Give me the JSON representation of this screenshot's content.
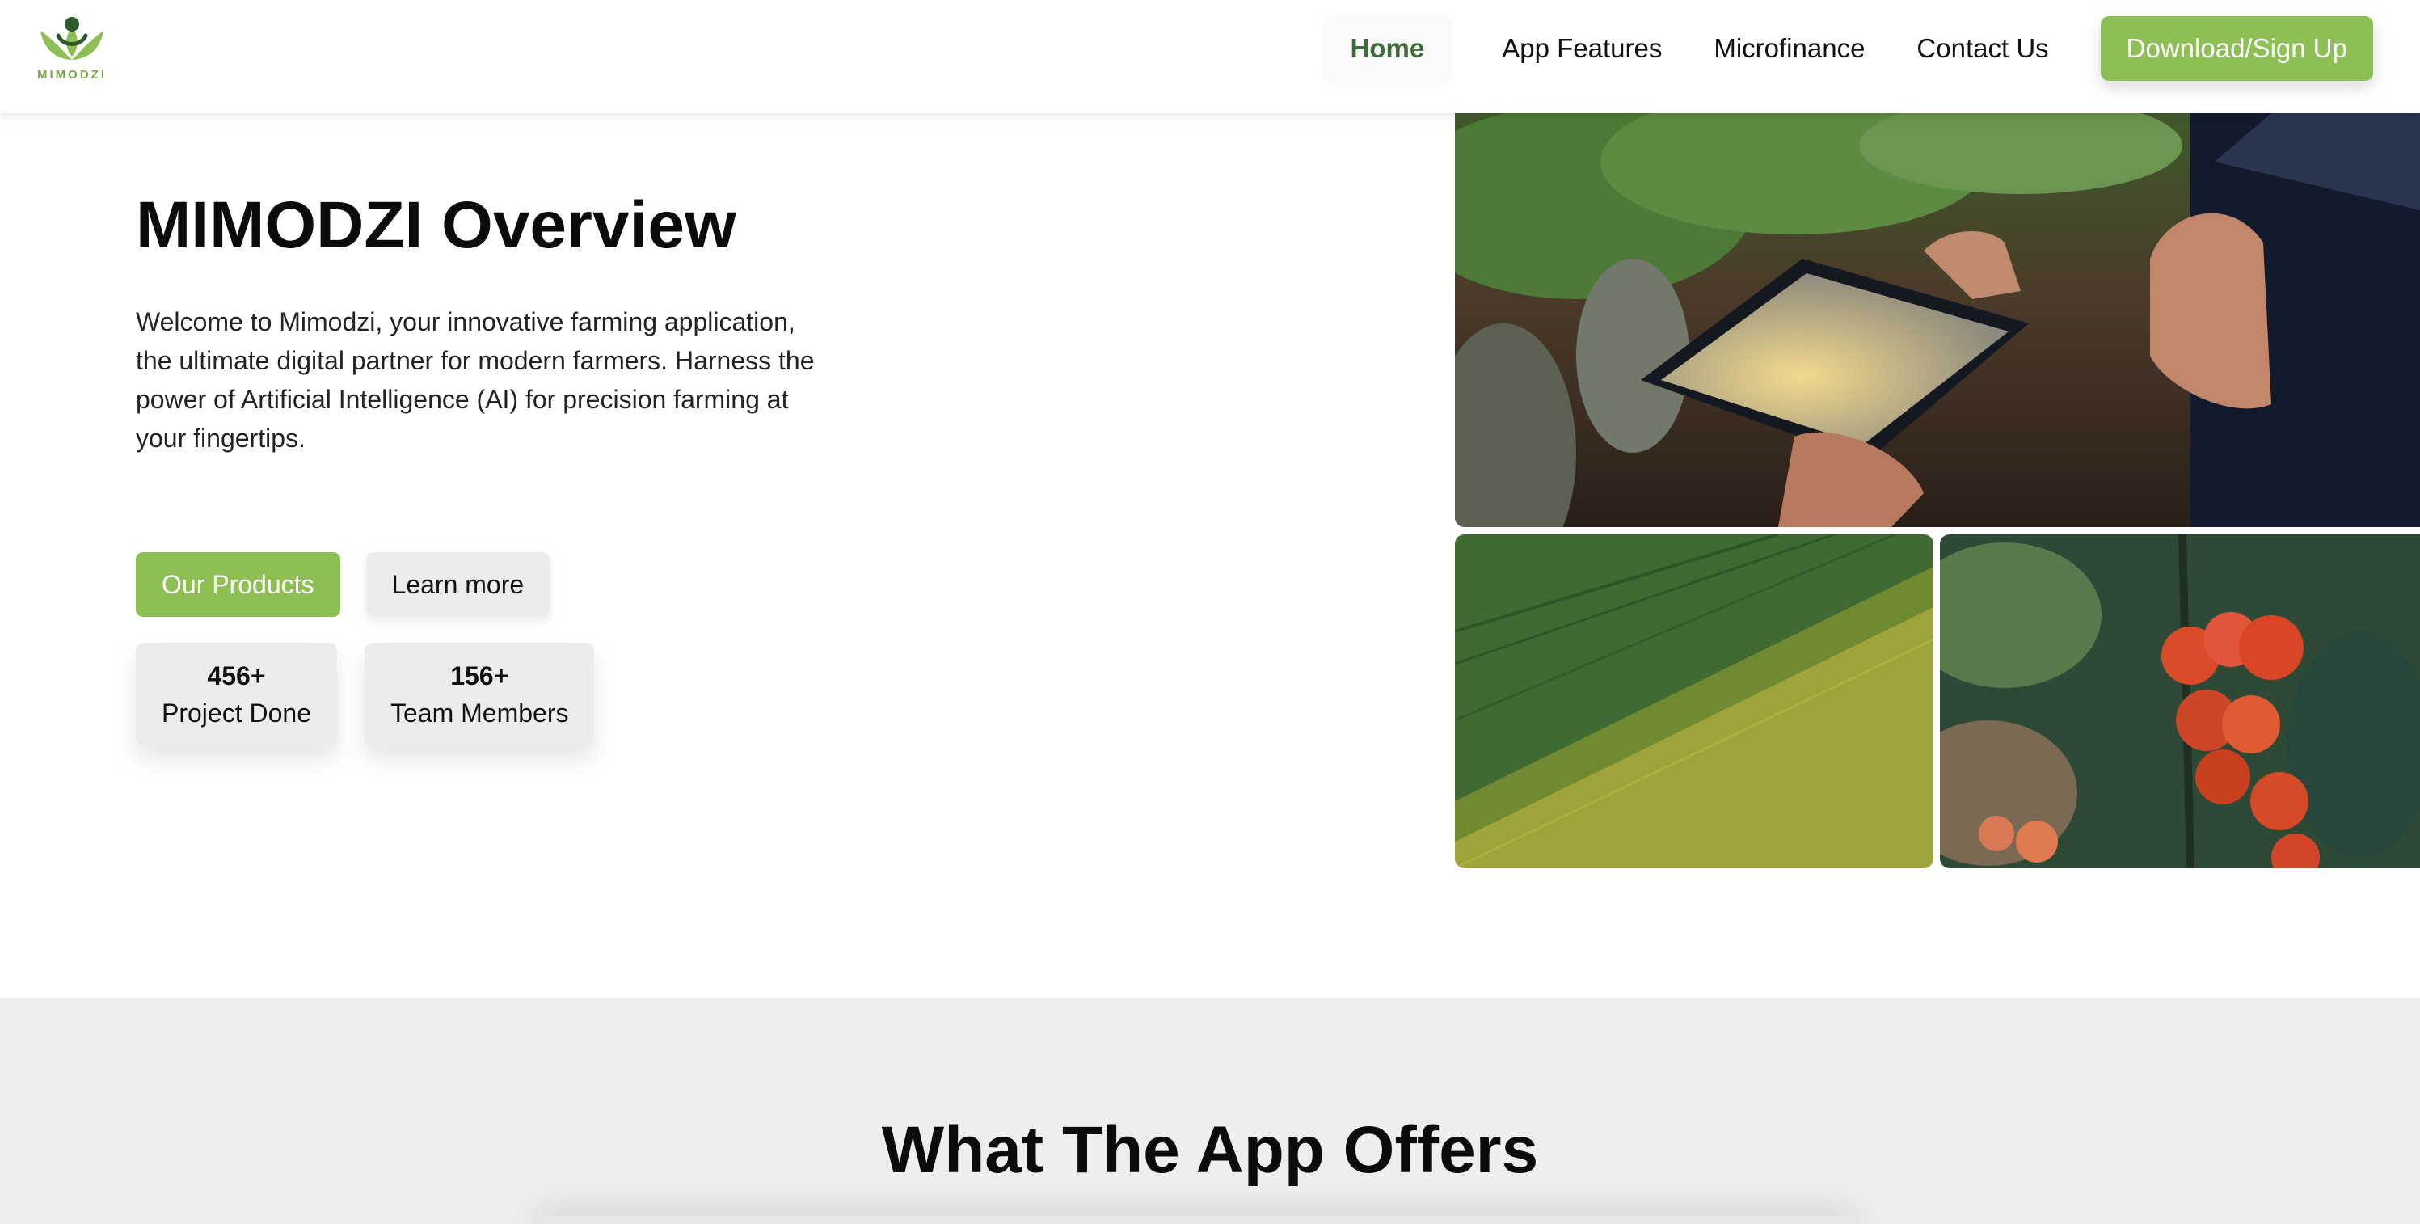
{
  "header": {
    "logo_text": "MIMODZI",
    "nav": {
      "home": "Home",
      "features": "App Features",
      "microfinance": "Microfinance",
      "contact": "Contact Us",
      "cta": "Download/Sign Up"
    }
  },
  "hero": {
    "title": "MIMODZI Overview",
    "description": "Welcome to Mimodzi, your innovative farming application, the ultimate digital partner for modern farmers. Harness the power of Artificial Intelligence (AI) for precision farming at your fingertips.",
    "primary_button": "Our Products",
    "secondary_button": "Learn more",
    "stats": [
      {
        "value": "456+",
        "label": "Project Done"
      },
      {
        "value": "156+",
        "label": "Team Members"
      }
    ]
  },
  "offers": {
    "title": "What The App Offers"
  },
  "colors": {
    "brand_green": "#8dbf54",
    "active_nav": "#3d6b3a",
    "section_bg": "#eeeeee"
  },
  "icons": [
    "mimodzi-logo-icon"
  ]
}
